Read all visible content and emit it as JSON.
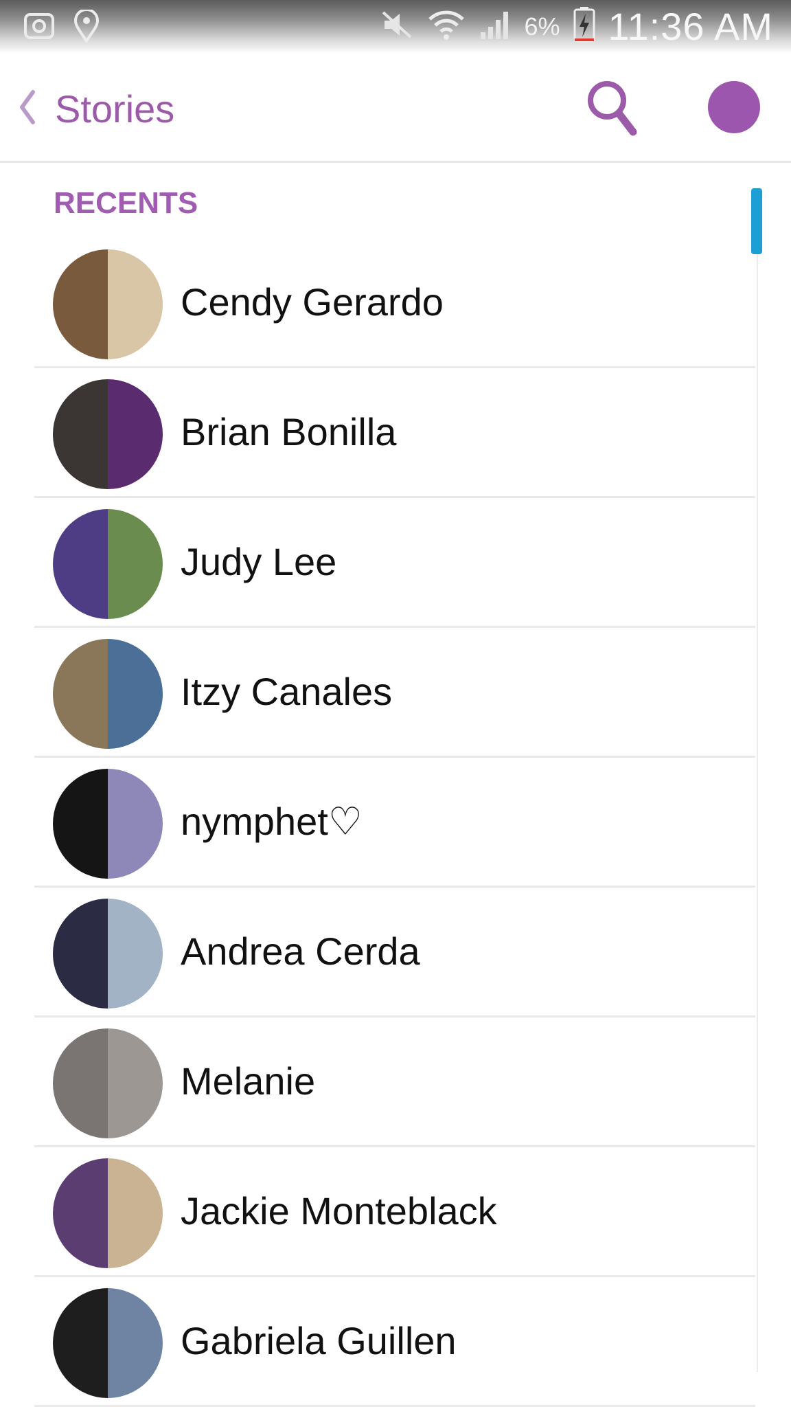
{
  "status_bar": {
    "battery_percent": "6%",
    "time": "11:36 AM"
  },
  "header": {
    "title": "Stories"
  },
  "section": {
    "label": "RECENTS"
  },
  "stories": [
    {
      "name": "Cendy Gerardo",
      "avatar_left": "#7a5a3c",
      "avatar_right": "#d8c6a7"
    },
    {
      "name": "Brian Bonilla",
      "avatar_left": "#3b3634",
      "avatar_right": "#5b2b6f"
    },
    {
      "name": "Judy Lee",
      "avatar_left": "#4e3d85",
      "avatar_right": "#6a8c4f"
    },
    {
      "name": "Itzy Canales",
      "avatar_left": "#8a7658",
      "avatar_right": "#4b6f96"
    },
    {
      "name": "nymphet♡",
      "avatar_left": "#151515",
      "avatar_right": "#8e88b9"
    },
    {
      "name": "Andrea Cerda",
      "avatar_left": "#2b2b44",
      "avatar_right": "#a1b3c4"
    },
    {
      "name": "Melanie",
      "avatar_left": "#7a7572",
      "avatar_right": "#9c9792"
    },
    {
      "name": "Jackie Monteblack",
      "avatar_left": "#5b3d72",
      "avatar_right": "#c9b393"
    },
    {
      "name": "Gabriela Guillen",
      "avatar_left": "#1e1e1e",
      "avatar_right": "#6f84a3"
    }
  ],
  "colors": {
    "accent": "#9c5ba8",
    "scrollbar": "#1d9fd6"
  }
}
